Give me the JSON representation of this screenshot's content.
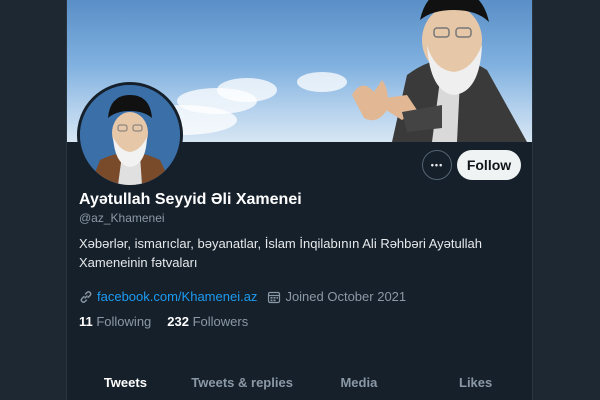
{
  "profile": {
    "name": "Ayətullah Seyyid Əli Xamenei",
    "handle": "@az_Khamenei",
    "bio": "Xəbərlər, ismarıclar, bəyanatlar, İslam İnqilabının Ali Rəhbəri Ayətullah Xameneinin fətvaları",
    "website": "facebook.com/Khamenei.az",
    "joined": "Joined October 2021"
  },
  "actions": {
    "more_label": "•••",
    "follow_label": "Follow"
  },
  "stats": {
    "following_count": "11",
    "following_label": "Following",
    "followers_count": "232",
    "followers_label": "Followers"
  },
  "tabs": [
    {
      "label": "Tweets",
      "active": true
    },
    {
      "label": "Tweets & replies",
      "active": false
    },
    {
      "label": "Media",
      "active": false
    },
    {
      "label": "Likes",
      "active": false
    }
  ],
  "icons": {
    "link": "link-icon",
    "calendar": "calendar-icon",
    "more": "more-icon"
  },
  "colors": {
    "background": "#15202b",
    "accent": "#1d9bf0",
    "muted": "#8b98a5"
  }
}
